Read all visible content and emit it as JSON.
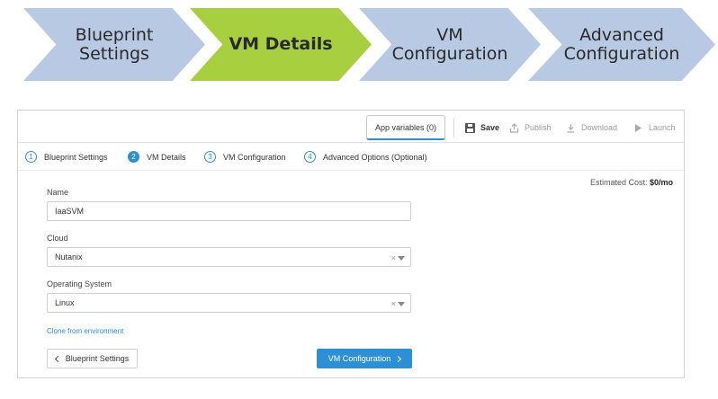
{
  "banner": {
    "steps": [
      {
        "label": "Blueprint\nSettings",
        "color": "#b8c9e3"
      },
      {
        "label": "VM Details",
        "color": "#a8cf3f"
      },
      {
        "label": "VM\nConfiguration",
        "color": "#b8c9e3"
      },
      {
        "label": "Advanced\nConfiguration",
        "color": "#b8c9e3"
      }
    ]
  },
  "toolbar": {
    "app_variables_label": "App variables (0)",
    "save_label": "Save",
    "publish_label": "Publish",
    "download_label": "Download",
    "launch_label": "Launch"
  },
  "stepper": {
    "steps": [
      {
        "num": "1",
        "label": "Blueprint Settings"
      },
      {
        "num": "2",
        "label": "VM Details"
      },
      {
        "num": "3",
        "label": "VM Configuration"
      },
      {
        "num": "4",
        "label": "Advanced Options (Optional)"
      }
    ]
  },
  "cost": {
    "label": "Estimated Cost:",
    "value": "$0/mo"
  },
  "form": {
    "name_label": "Name",
    "name_value": "IaaSVM",
    "cloud_label": "Cloud",
    "cloud_value": "Nutanix",
    "os_label": "Operating System",
    "os_value": "Linux",
    "clear_glyph": "×",
    "clone_link": "Clone from environment"
  },
  "nav": {
    "back_label": "Blueprint Settings",
    "next_label": "VM Configuration"
  },
  "colors": {
    "accent": "#2d8fd6",
    "chevron_active": "#a8cf3f",
    "chevron_inactive": "#b8c9e3"
  }
}
